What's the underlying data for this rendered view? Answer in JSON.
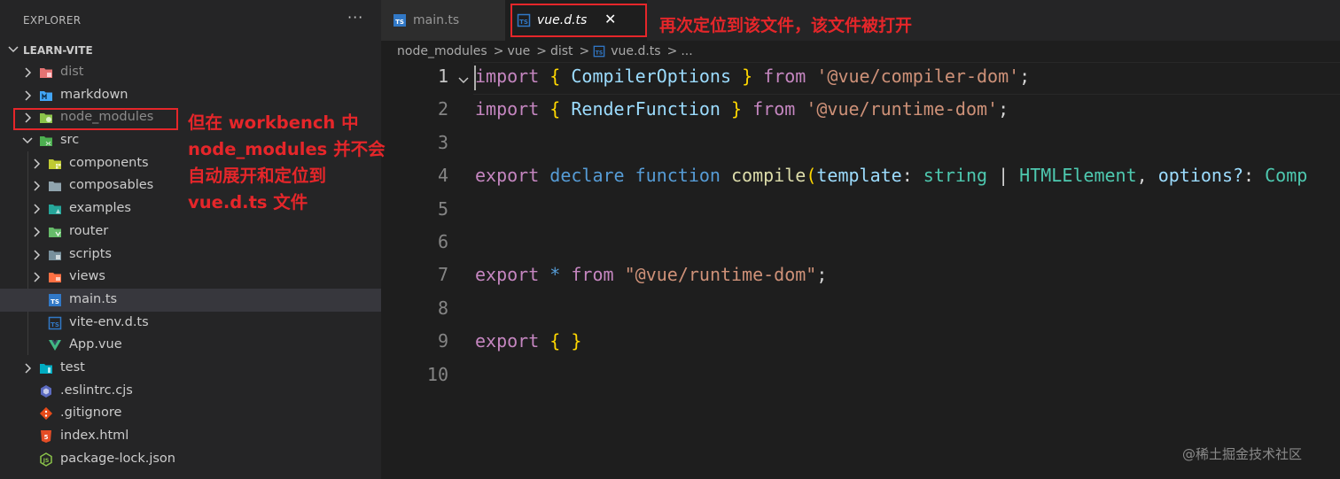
{
  "sidebar": {
    "title": "EXPLORER",
    "more_label": "···",
    "root": "LEARN-VITE",
    "items": [
      {
        "label": "dist",
        "icon": "folder-dist-icon"
      },
      {
        "label": "markdown",
        "icon": "folder-markdown-icon"
      },
      {
        "label": "node_modules",
        "icon": "folder-node-icon"
      },
      {
        "label": "src",
        "icon": "folder-src-icon"
      },
      {
        "label": "components",
        "icon": "folder-components-icon"
      },
      {
        "label": "composables",
        "icon": "folder-composables-icon"
      },
      {
        "label": "examples",
        "icon": "folder-examples-icon"
      },
      {
        "label": "router",
        "icon": "folder-router-icon"
      },
      {
        "label": "scripts",
        "icon": "folder-scripts-icon"
      },
      {
        "label": "views",
        "icon": "folder-views-icon"
      },
      {
        "label": "main.ts",
        "icon": "typescript-file-icon"
      },
      {
        "label": "vite-env.d.ts",
        "icon": "typescript-def-file-icon"
      },
      {
        "label": "App.vue",
        "icon": "vue-file-icon"
      },
      {
        "label": "test",
        "icon": "folder-test-icon"
      },
      {
        "label": ".eslintrc.cjs",
        "icon": "eslint-file-icon"
      },
      {
        "label": ".gitignore",
        "icon": "git-file-icon"
      },
      {
        "label": "index.html",
        "icon": "html-file-icon"
      },
      {
        "label": "package-lock.json",
        "icon": "nodejs-file-icon"
      }
    ]
  },
  "tabs": [
    {
      "label": "main.ts",
      "icon": "typescript-file-icon"
    },
    {
      "label": "vue.d.ts",
      "icon": "typescript-def-file-icon",
      "close": "✕"
    }
  ],
  "breadcrumb": {
    "parts": [
      "node_modules",
      "vue",
      "dist"
    ],
    "file": "vue.d.ts",
    "symbol": "..."
  },
  "editor": {
    "line_numbers": [
      "1",
      "2",
      "3",
      "4",
      "5",
      "6",
      "7",
      "8",
      "9",
      "10"
    ],
    "line1": {
      "a": "import",
      "b": "{",
      "c": "CompilerOptions",
      "d": "}",
      "e": "from",
      "f": "'@vue/compiler-dom'",
      "g": ";"
    },
    "line2": {
      "a": "import",
      "b": "{",
      "c": "RenderFunction",
      "d": "}",
      "e": "from",
      "f": "'@vue/runtime-dom'",
      "g": ";"
    },
    "line4": {
      "a": "export",
      "b": "declare",
      "c": "function",
      "d": "compile",
      "e": "(",
      "f": "template",
      "g": ":",
      "h": "string",
      "i": "|",
      "j": "HTMLElement",
      "k": ",",
      "l": "options?",
      "m": ":",
      "n": "Comp"
    },
    "line7": {
      "a": "export",
      "b": "*",
      "c": "from",
      "d": "\"@vue/runtime-dom\"",
      "e": ";"
    },
    "line9": {
      "a": "export",
      "b": "{",
      "c": "}"
    }
  },
  "annotations": {
    "tab_note": "再次定位到该文件，该文件被打开",
    "side_note": [
      "但在 workbench 中",
      "node_modules 并不会",
      "自动展开和定位到",
      "vue.d.ts 文件"
    ]
  },
  "watermark": "@稀土掘金技术社区",
  "colors": {
    "sidebar_bg": "#252526",
    "editor_bg": "#1e1e1e",
    "annotation_red": "#e5262a",
    "keyword": "#c586c0",
    "string": "#ce9178"
  }
}
